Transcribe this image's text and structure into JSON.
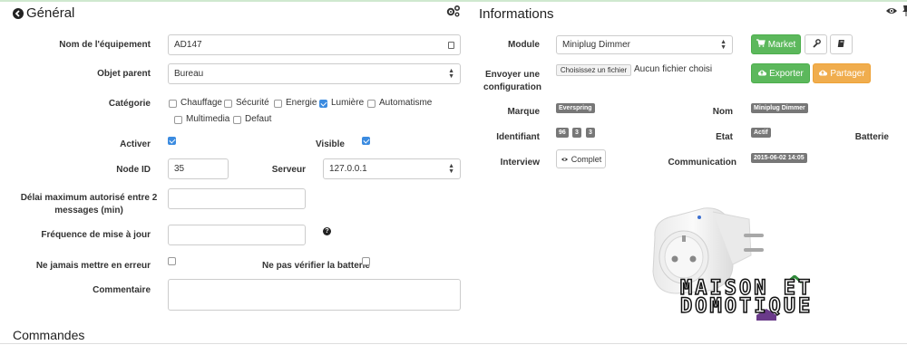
{
  "general": {
    "title": "Général",
    "fields": {
      "name_label": "Nom de l'équipement",
      "name_value": "AD147",
      "parent_label": "Objet parent",
      "parent_value": "Bureau",
      "category_label": "Catégorie",
      "categories": [
        {
          "label": "Chauffage",
          "checked": false
        },
        {
          "label": "Sécurité",
          "checked": false
        },
        {
          "label": "Energie",
          "checked": false
        },
        {
          "label": "Lumière",
          "checked": true
        },
        {
          "label": "Automatisme",
          "checked": false
        },
        {
          "label": "Multimedia",
          "checked": false
        },
        {
          "label": "Defaut",
          "checked": false
        }
      ],
      "activate_label": "Activer",
      "activate_checked": true,
      "visible_label": "Visible",
      "visible_checked": true,
      "nodeid_label": "Node ID",
      "nodeid_value": "35",
      "server_label": "Serveur",
      "server_value": "127.0.0.1",
      "delay_label": "Délai maximum autorisé entre 2 messages (min)",
      "delay_value": "",
      "freq_label": "Fréquence de mise à jour",
      "freq_value": "",
      "noerror_label": "Ne jamais mettre en erreur",
      "noerror_checked": false,
      "nobattery_label": "Ne pas vérifier la batterie",
      "nobattery_checked": false,
      "comment_label": "Commentaire",
      "comment_value": ""
    }
  },
  "info": {
    "title": "Informations",
    "module_label": "Module",
    "module_value": "Miniplug Dimmer",
    "market_label": "Market",
    "send_config_label": "Envoyer une configuration",
    "file_button": "Choisissez un fichier",
    "file_status": "Aucun fichier choisi",
    "export_label": "Exporter",
    "share_label": "Partager",
    "brand_label": "Marque",
    "brand_value": "Everspring",
    "name_label": "Nom",
    "name_value": "Miniplug Dimmer",
    "id_label": "Identifiant",
    "id_values": [
      "96",
      "3",
      "3"
    ],
    "state_label": "Etat",
    "state_value": "Actif",
    "battery_label": "Batterie",
    "interview_label": "Interview",
    "complete_label": "Complet",
    "comm_label": "Communication",
    "comm_value": "2015-06-02 14:05",
    "watermark_line1": "MAISON ET",
    "watermark_line2": "DOMOTIQUE"
  },
  "commands": {
    "title": "Commandes"
  },
  "colors": {
    "green": "#5cb85c",
    "orange": "#f0ad4e",
    "checkbox_blue": "#3b8be0",
    "badge_grey": "#777777"
  }
}
